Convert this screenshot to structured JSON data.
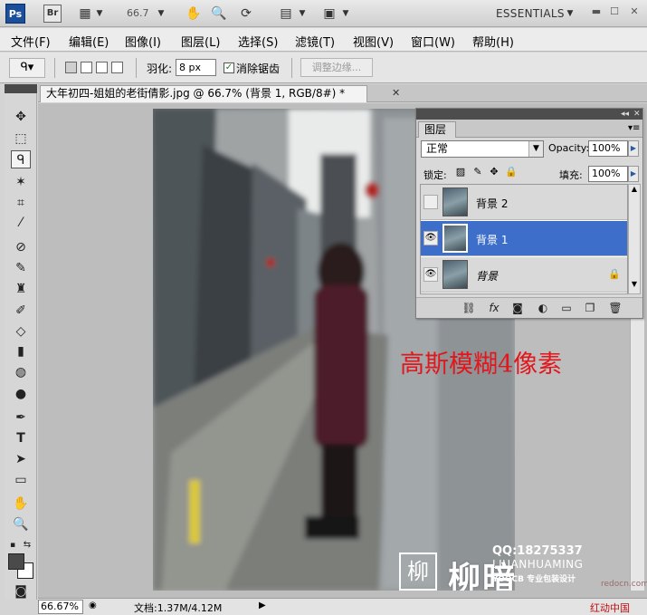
{
  "app": {
    "logo": "Ps",
    "bridge": "Br",
    "zoom": "66.7",
    "workspace": "ESSENTIALS"
  },
  "menu": {
    "items": [
      "文件(F)",
      "编辑(E)",
      "图像(I)",
      "图层(L)",
      "选择(S)",
      "滤镜(T)",
      "视图(V)",
      "窗口(W)",
      "帮助(H)"
    ]
  },
  "options": {
    "feather_label": "羽化:",
    "feather_value": "8 px",
    "antialias_label": "消除锯齿",
    "refine_edge_label": "调整边缘..."
  },
  "document": {
    "tab_title": "大年初四-姐姐的老街倩影.jpg @ 66.7% (背景 1, RGB/8#) *",
    "annotation": "高斯模糊4像素",
    "watermark": {
      "logo_char": "柳",
      "brand": "柳暗花明",
      "qq": "QQ:18275337",
      "pinyin": "LIUANHUAMING",
      "yoocb": "YOOCB 专业包装设计"
    },
    "site_url": "redocn.com"
  },
  "status": {
    "zoom": "66.67%",
    "doc_info": "文档:1.37M/4.12M",
    "site_watermark": "红动中国"
  },
  "layers_panel": {
    "tab": "图层",
    "blend_mode": "正常",
    "opacity_label": "Opacity:",
    "opacity_value": "100%",
    "lock_label": "锁定:",
    "fill_label": "填充:",
    "fill_value": "100%",
    "layers": [
      {
        "name": "背景 2",
        "visible": false,
        "selected": false,
        "locked": false
      },
      {
        "name": "背景 1",
        "visible": true,
        "selected": true,
        "locked": false
      },
      {
        "name": "背景",
        "visible": true,
        "selected": false,
        "locked": true
      }
    ]
  },
  "colors": {
    "selection_blue": "#3d6ec9",
    "annotation_red": "#e3161c",
    "foreground": "#4a4a4a",
    "background": "#ffffff"
  }
}
